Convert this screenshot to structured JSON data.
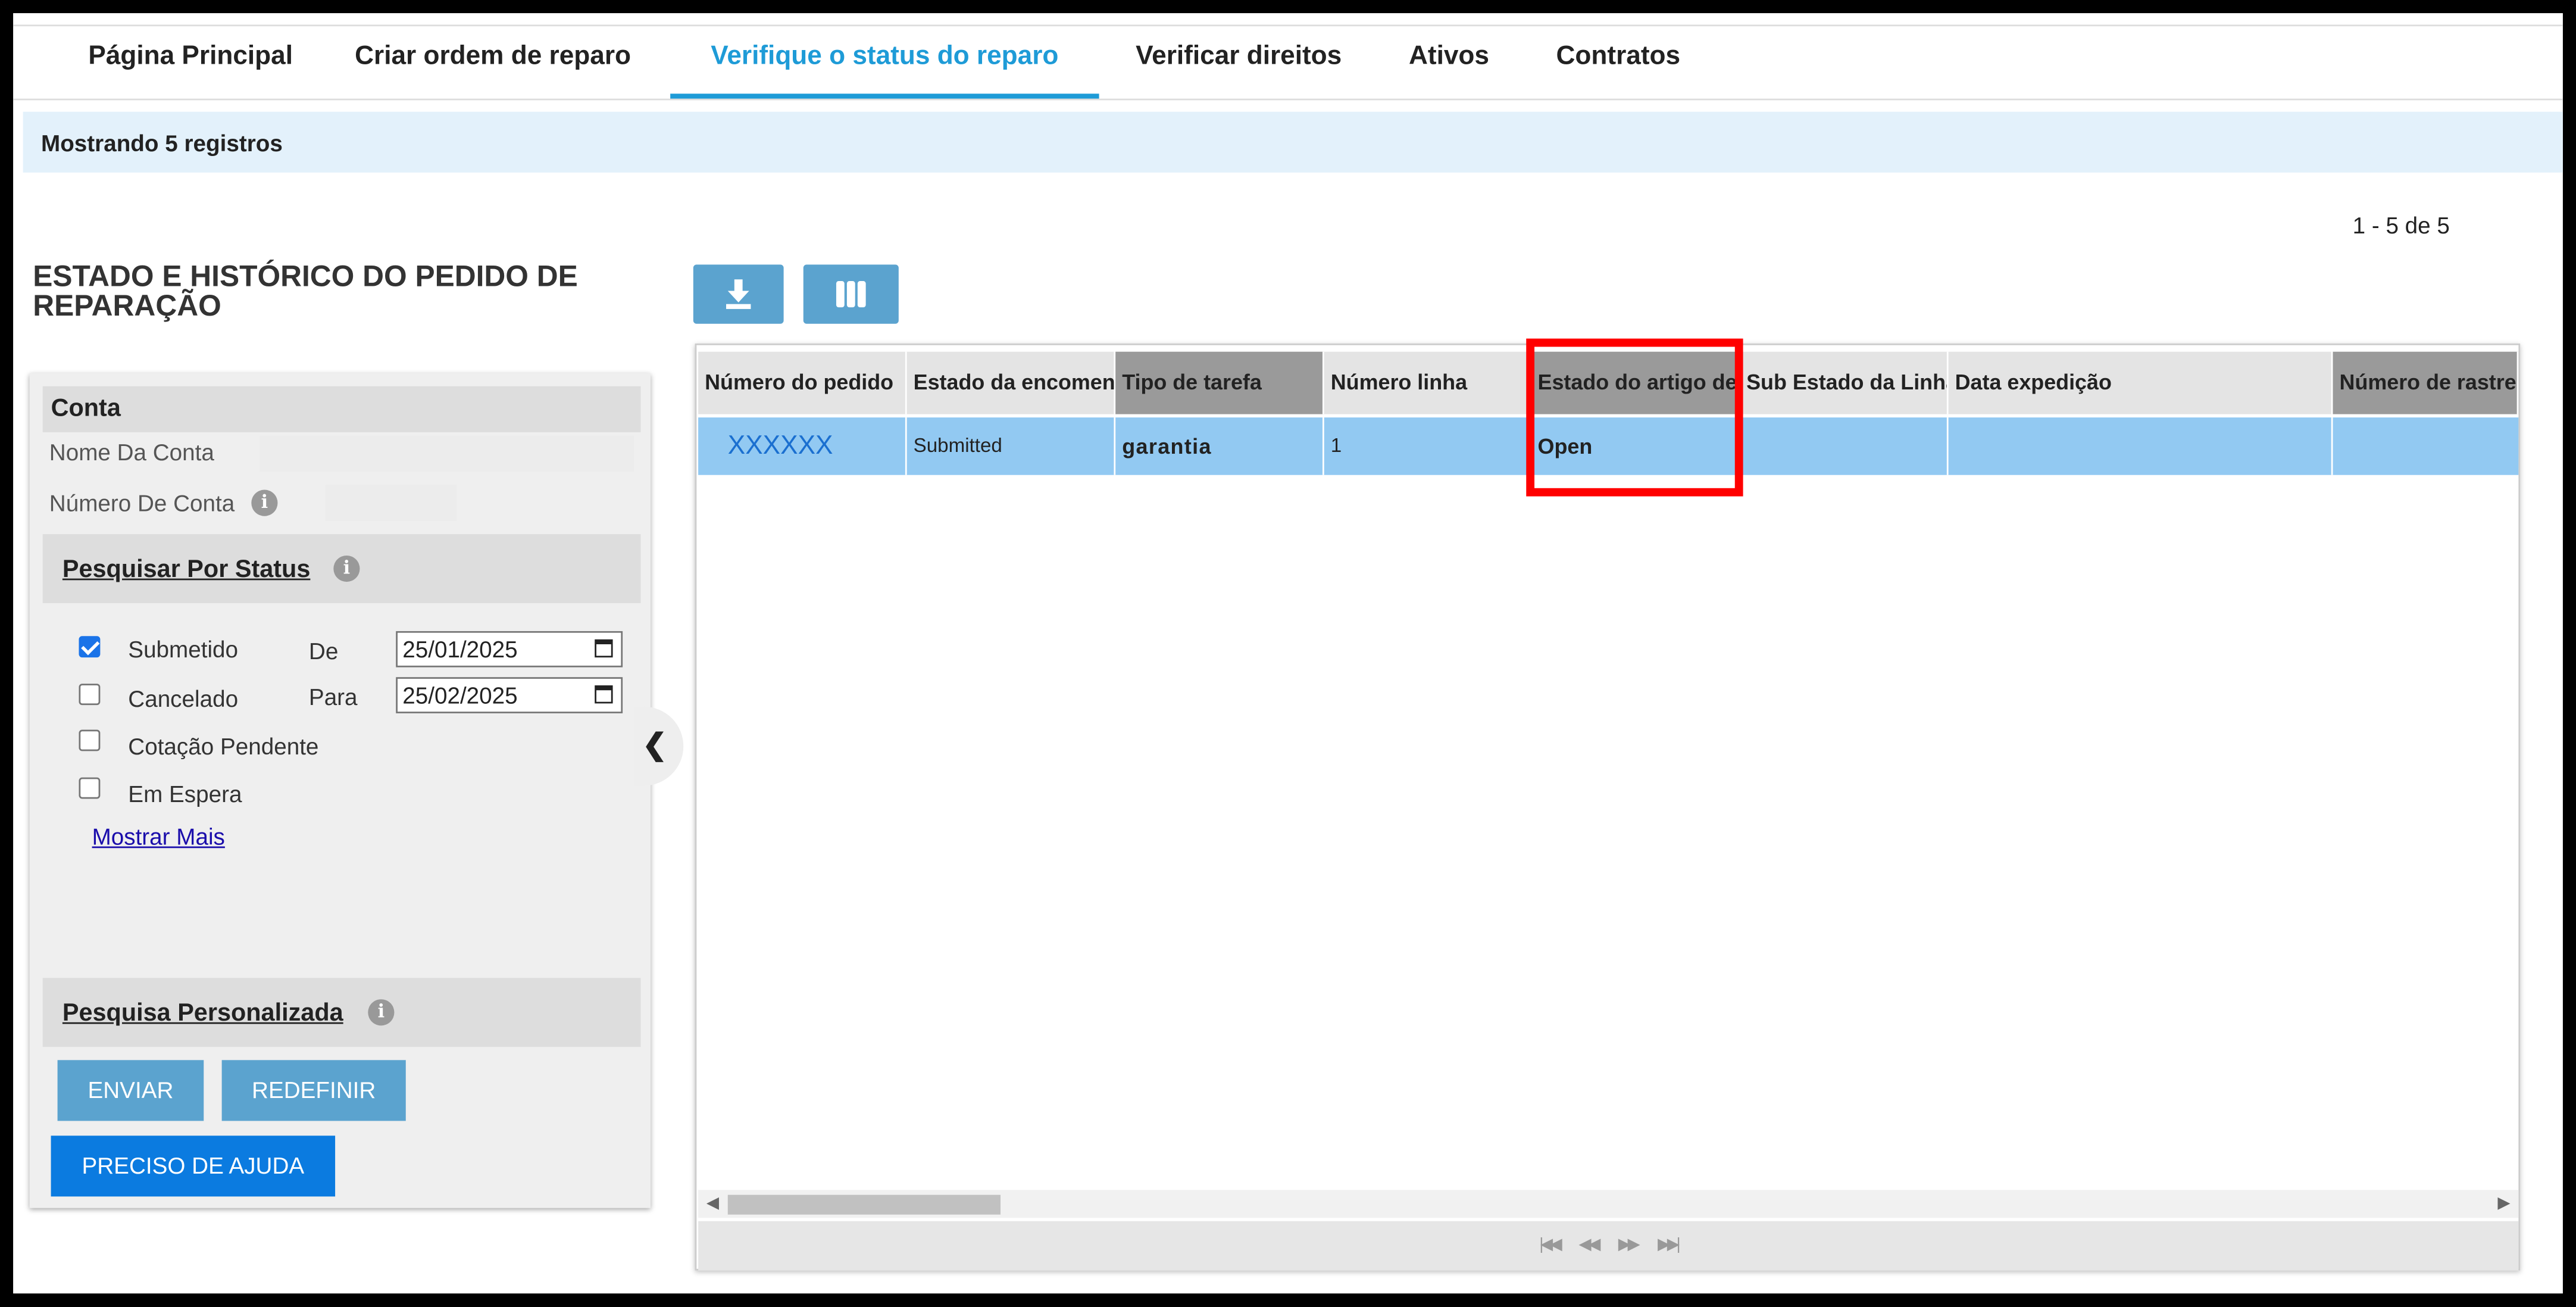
{
  "nav": {
    "tabs": [
      {
        "label": "Página Principal"
      },
      {
        "label": "Criar ordem de reparo"
      },
      {
        "label": "Verifique o status do reparo"
      },
      {
        "label": "Verificar direitos"
      },
      {
        "label": "Ativos"
      },
      {
        "label": "Contratos"
      }
    ],
    "active": "Verifique o status do reparo"
  },
  "banner": {
    "text": "Mostrando 5 registros"
  },
  "pagination": {
    "summary": "1 - 5 de 5"
  },
  "page_title": "ESTADO E HISTÓRICO DO PEDIDO DE REPARAÇÃO",
  "account": {
    "heading": "Conta",
    "name_label": "Nome Da Conta",
    "number_label": "Número De Conta"
  },
  "status_search": {
    "heading": "Pesquisar Por Status",
    "options": [
      {
        "label": "Submetido",
        "checked": true
      },
      {
        "label": "Cancelado",
        "checked": false
      },
      {
        "label": "Cotação Pendente",
        "checked": false
      },
      {
        "label": "Em Espera",
        "checked": false
      }
    ],
    "from_label": "De",
    "from_value": "25/01/2025",
    "to_label": "Para",
    "to_value": "25/02/2025",
    "show_more": "Mostrar Mais"
  },
  "custom_search": {
    "heading": "Pesquisa Personalizada"
  },
  "buttons": {
    "submit": "ENVIAR",
    "reset": "REDEFINIR",
    "help": "PRECISO DE AJUDA"
  },
  "toolbar": {
    "download_icon": "download-icon",
    "columns_icon": "columns-icon"
  },
  "table": {
    "columns": [
      "Número do pedido",
      "Estado da encomenda",
      "Tipo de tarefa",
      "Número linha",
      "Estado do artigo de",
      "Sub Estado da Linha",
      "Data expedição",
      "Número de rastreio"
    ],
    "rows": [
      {
        "order_number": "XXXXXX",
        "order_status": "Submitted",
        "task_type": "garantia",
        "line_number": "1",
        "item_status": "Open",
        "sub_status": "",
        "ship_date": "",
        "tracking": ""
      }
    ]
  },
  "colors": {
    "accent": "#1e9bd7",
    "button": "#5ba3cf",
    "help_button": "#0b7be0",
    "selected_row": "#92c9f2",
    "highlight_box": "#ff0000"
  }
}
